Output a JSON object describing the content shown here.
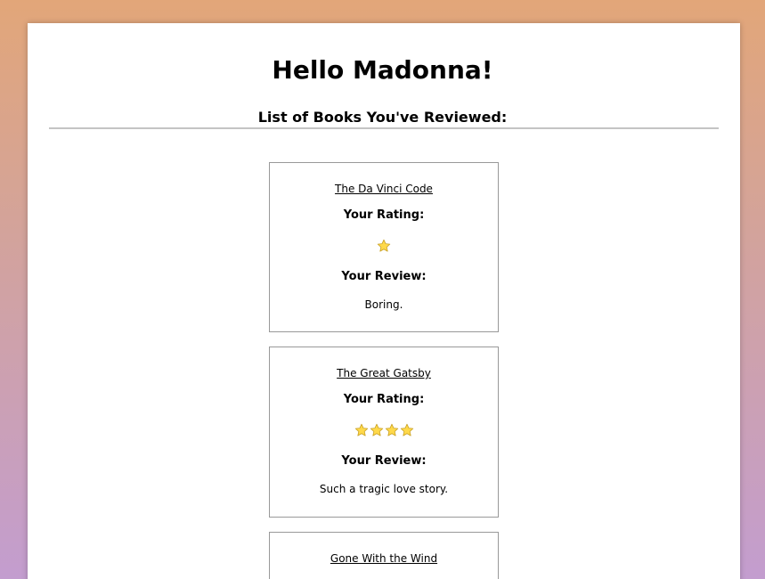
{
  "header": {
    "greeting": "Hello Madonna!",
    "list_heading": "List of Books You've Reviewed:"
  },
  "labels": {
    "rating": "Your Rating:",
    "review": "Your Review:"
  },
  "colors": {
    "star_fill": "#ffd94a",
    "star_stroke": "#c9a227"
  },
  "books": [
    {
      "title": "The Da Vinci Code",
      "rating": 1,
      "review": "Boring."
    },
    {
      "title": "The Great Gatsby",
      "rating": 4,
      "review": "Such a tragic love story."
    },
    {
      "title": "Gone With the Wind"
    }
  ]
}
